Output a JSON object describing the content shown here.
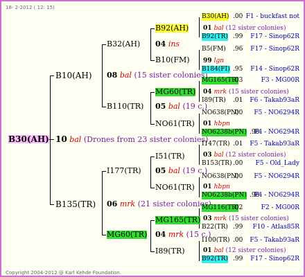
{
  "header": {
    "date": "18-  2-2012 ( 12: 15)"
  },
  "footer": {
    "copyright": "Copyright 2004-2012 @ Karl Kehde Foundation."
  },
  "root": {
    "queen": "B30(AH)",
    "count": "10",
    "race": "bal",
    "note": "(Drones from 23 sister colonies)"
  },
  "gen2": [
    {
      "queen": "B10(AH)",
      "count": "08",
      "race": "bal",
      "note": "(15 sister colonies)"
    },
    {
      "queen": "B135(TR)",
      "count": "06",
      "race": "mrk",
      "note": "(21 sister colonies)"
    }
  ],
  "gen3": [
    {
      "queen": "B32(AH)",
      "count": "04",
      "race": "ins",
      "note": ""
    },
    {
      "queen": "B110(TR)",
      "count": "05",
      "race": "bal",
      "note": "(19 c.)"
    },
    {
      "queen": "I177(TR)",
      "count": "05",
      "race": "bal",
      "note": "(19 c.)"
    },
    {
      "queen": "MG60(TR)",
      "count": "04",
      "race": "mrk",
      "note": "(15 c.)"
    }
  ],
  "gen4": [
    {
      "queen": "B92(AH)"
    },
    {
      "queen": "B10(FM)"
    },
    {
      "queen": "MG60(TR)"
    },
    {
      "queen": "NO61(TR)"
    },
    {
      "queen": "I51(TR)"
    },
    {
      "queen": "NO61(TR)"
    },
    {
      "queen": "MG165(TR)"
    },
    {
      "queen": "I89(TR)"
    }
  ],
  "gen5": [
    {
      "queen": "B30(AH)",
      "value": ".00",
      "breeder": "F1 - buckfast not",
      "hl": "yellow"
    },
    {
      "count": "01",
      "race": "bal",
      "note": "(12 sister colonies)"
    },
    {
      "queen": "B92(TR)",
      "value": ".99",
      "breeder": "F17 - Sinop62R",
      "hl": "cyan"
    },
    {
      "queen": "B5(FM)",
      "value": ".96",
      "breeder": "F17 - Sinop62R",
      "hl": ""
    },
    {
      "count": "99",
      "race": "lgn",
      "note": ""
    },
    {
      "queen": "B184(FI)",
      "value": ".95",
      "breeder": "F14 - Sinop62R",
      "hl": "cyan"
    },
    {
      "queen": "MG165(TR)",
      "value": ".03",
      "breeder": "F3 - MG00R",
      "hl": "green"
    },
    {
      "count": "04",
      "race": "mrk",
      "note": "(15 sister colonies)"
    },
    {
      "queen": "I89(TR)",
      "value": ".01",
      "breeder": "F6 - Takab93aR",
      "hl": ""
    },
    {
      "queen": "NO638(PN)",
      "value": ".00",
      "breeder": "F5 - NO6294R",
      "hl": ""
    },
    {
      "count": "01",
      "race": "hbpn",
      "note": ""
    },
    {
      "queen": "NO6238b(PN)",
      "value": ".98",
      "breeder": "F4 - NO6294R",
      "hl": "green"
    },
    {
      "queen": "I147(TR)",
      "value": ".01",
      "breeder": "F5 - Takab93aR",
      "hl": ""
    },
    {
      "count": "03",
      "race": "bal",
      "note": "(12 sister colonies)"
    },
    {
      "queen": "B153(TR)",
      "value": ".00",
      "breeder": "F5 - Old_Lady",
      "hl": ""
    },
    {
      "queen": "NO638(PN)",
      "value": ".00",
      "breeder": "F5 - NO6294R",
      "hl": ""
    },
    {
      "count": "01",
      "race": "hbpn",
      "note": ""
    },
    {
      "queen": "NO6238b(PN)",
      "value": ".98",
      "breeder": "F4 - NO6294R",
      "hl": "green"
    },
    {
      "queen": "MG116(TR)",
      "value": ".02",
      "breeder": "F2 - MG00R",
      "hl": "green"
    },
    {
      "count": "03",
      "race": "mrk",
      "note": "(15 sister colonies)"
    },
    {
      "queen": "B22(TR)",
      "value": ".99",
      "breeder": "F10 - Atlas85R",
      "hl": ""
    },
    {
      "queen": "I100(TR)",
      "value": ".00",
      "breeder": "F5 - Takab93aR",
      "hl": ""
    },
    {
      "count": "01",
      "race": "bal",
      "note": "(12 sister colonies)"
    },
    {
      "queen": "B92(TR)",
      "value": ".99",
      "breeder": "F17 - Sinop62R",
      "hl": "cyan"
    }
  ]
}
